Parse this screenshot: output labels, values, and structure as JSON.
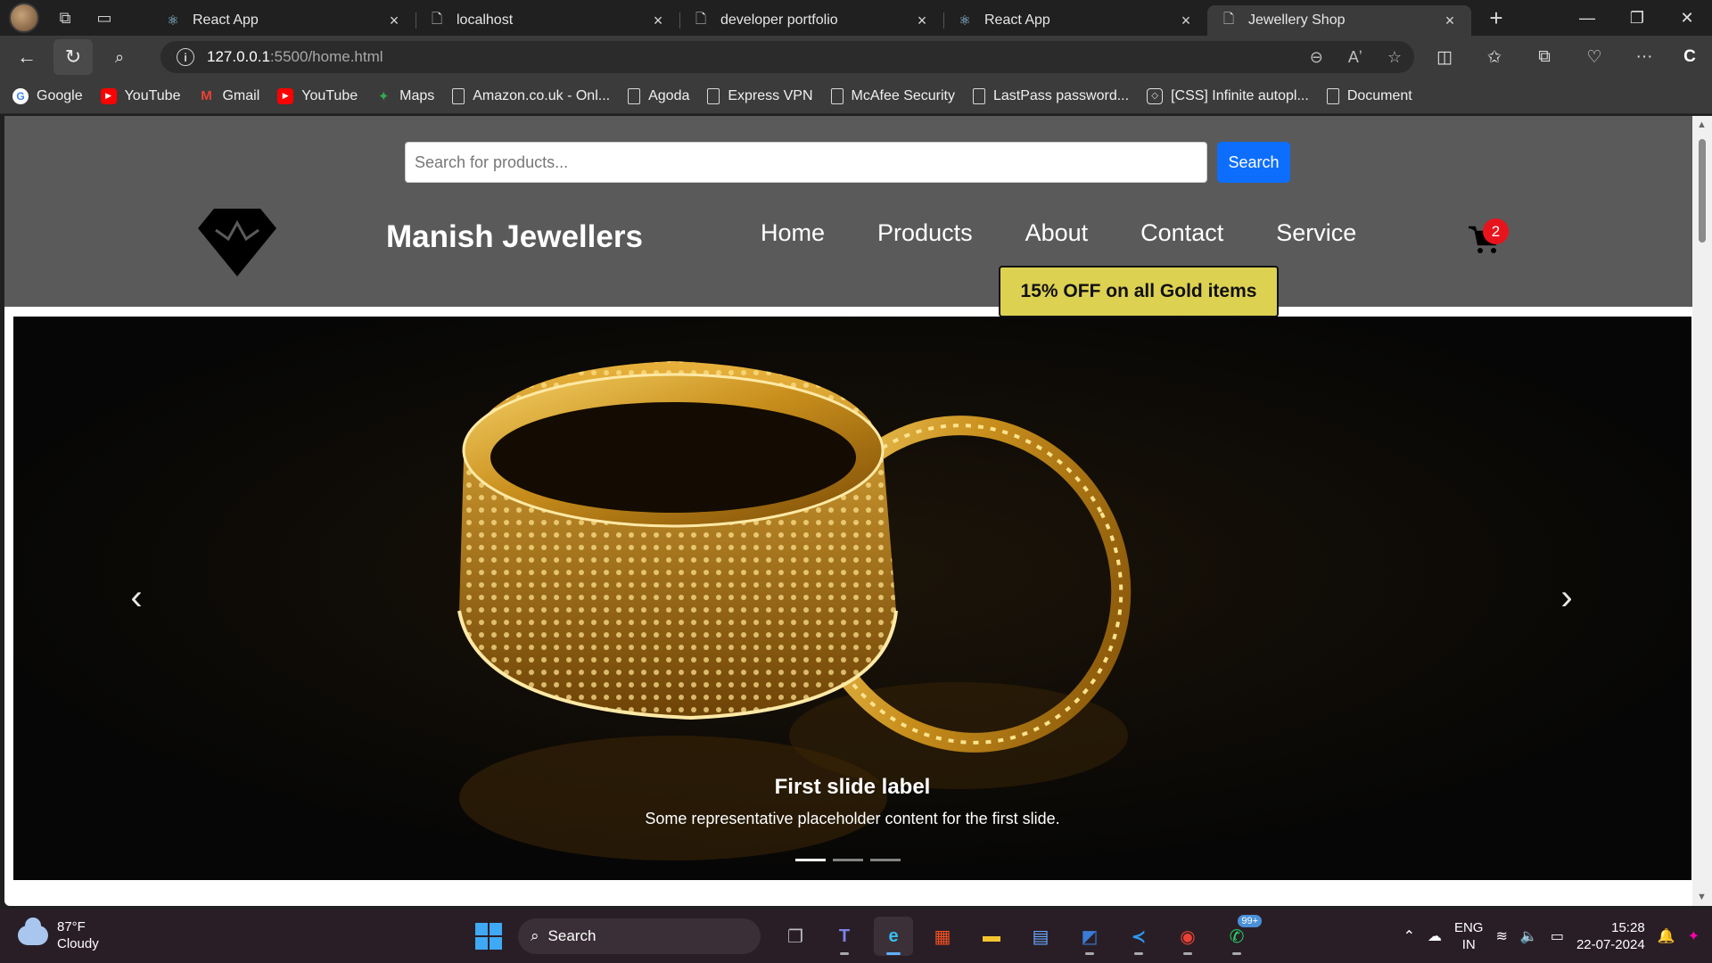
{
  "browser": {
    "tabs": [
      {
        "label": "React App",
        "icon": "react-icon"
      },
      {
        "label": "localhost",
        "icon": "page-icon"
      },
      {
        "label": "developer portfolio",
        "icon": "page-icon"
      },
      {
        "label": "React App",
        "icon": "react-icon"
      },
      {
        "label": "Jewellery Shop",
        "icon": "page-icon",
        "active": true
      }
    ],
    "url_host": "127.0.0.1",
    "url_rest": ":5500/home.html",
    "bookmarks": [
      {
        "label": "Google",
        "icon": "google"
      },
      {
        "label": "YouTube",
        "icon": "youtube"
      },
      {
        "label": "Gmail",
        "icon": "gmail"
      },
      {
        "label": "YouTube",
        "icon": "youtube"
      },
      {
        "label": "Maps",
        "icon": "maps"
      },
      {
        "label": "Amazon.co.uk - Onl...",
        "icon": "page"
      },
      {
        "label": "Agoda",
        "icon": "page"
      },
      {
        "label": "Express VPN",
        "icon": "page"
      },
      {
        "label": "McAfee Security",
        "icon": "page"
      },
      {
        "label": "LastPass password...",
        "icon": "page"
      },
      {
        "label": "[CSS] Infinite autopl...",
        "icon": "css"
      },
      {
        "label": "Document",
        "icon": "page"
      }
    ]
  },
  "site": {
    "search_placeholder": "Search for products...",
    "search_button": "Search",
    "brand": "Manish Jewellers",
    "nav": [
      "Home",
      "Products",
      "About",
      "Contact",
      "Service"
    ],
    "cart_count": "2",
    "offer": "15% OFF on all Gold items",
    "carousel": {
      "caption_title": "First slide label",
      "caption_text": "Some representative placeholder content for the first slide.",
      "slides": 3,
      "active_slide": 1
    }
  },
  "taskbar": {
    "temperature": "87°F",
    "condition": "Cloudy",
    "search_label": "Search",
    "whatsapp_badge": "99+",
    "lang_1": "ENG",
    "lang_2": "IN",
    "time": "15:28",
    "date": "22-07-2024"
  },
  "colors": {
    "header_bg": "#5a5a5a",
    "search_button": "#0d6efd",
    "offer_bg": "#ddd152",
    "cart_badge": "#e8141d"
  }
}
